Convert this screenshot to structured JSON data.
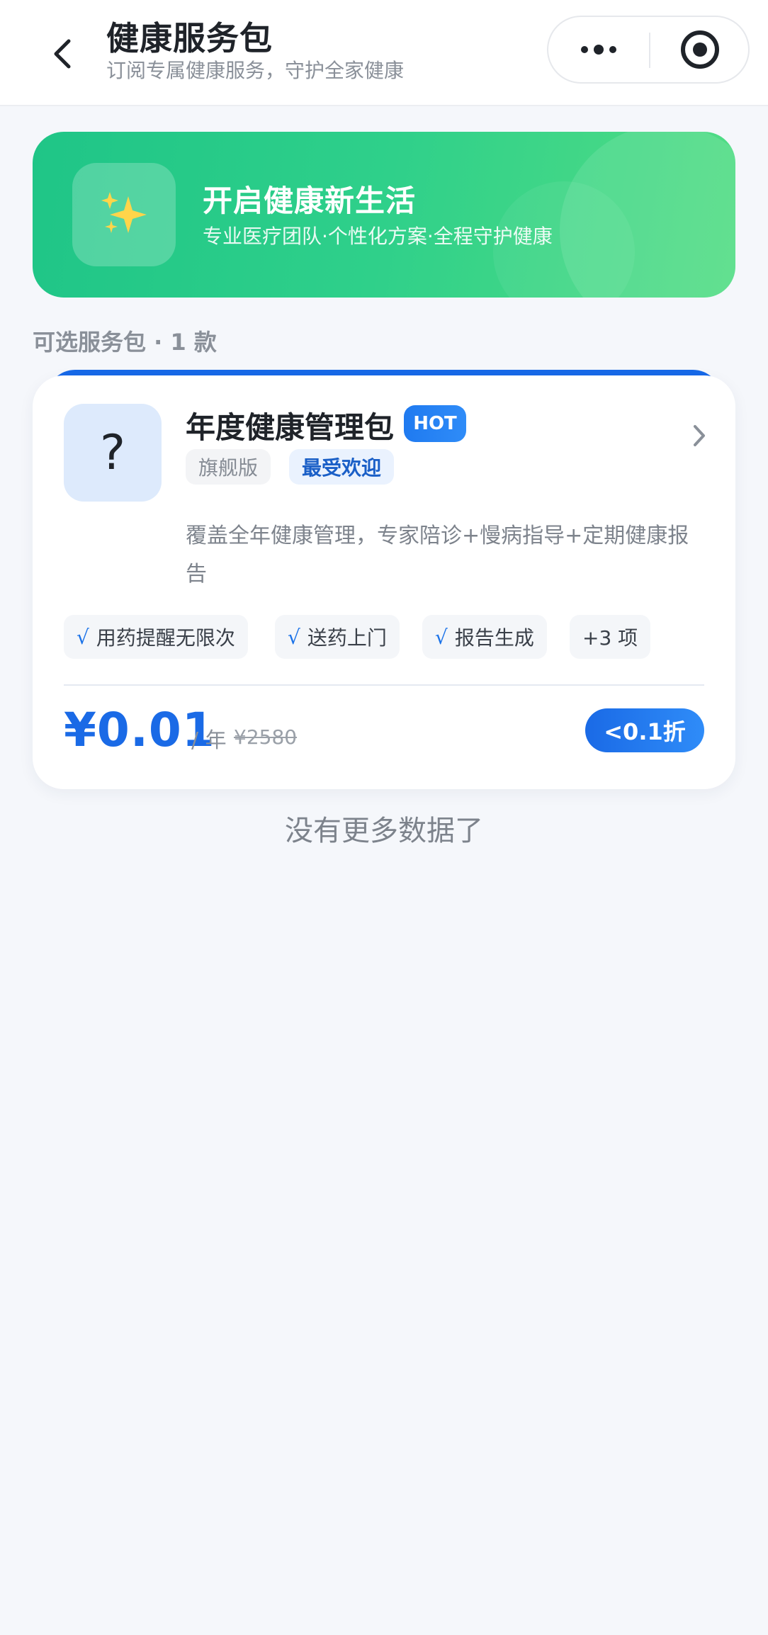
{
  "header": {
    "title": "健康服务包",
    "subtitle": "订阅专属健康服务，守护全家健康"
  },
  "banner": {
    "title": "开启健康新生活",
    "subtitle": "专业医疗团队·个性化方案·全程守护健康",
    "icon": "sparkles-icon"
  },
  "section": {
    "label": "可选服务包 · 1 款"
  },
  "product": {
    "icon_glyph": "?",
    "name": "年度健康管理包",
    "badge": "HOT",
    "edition": "旗舰版",
    "popular": "最受欢迎",
    "description": "覆盖全年健康管理，专家陪诊+慢病指导+定期健康报告",
    "features": [
      {
        "check": "√",
        "label": "用药提醒无限次"
      },
      {
        "check": "√",
        "label": "送药上门"
      },
      {
        "check": "√",
        "label": "报告生成"
      }
    ],
    "more_features": "+3 项",
    "price": "¥0.01",
    "price_unit": "/ 年",
    "original_price": "¥2580",
    "discount": "<0.1折"
  },
  "footer": {
    "no_more": "没有更多数据了"
  },
  "colors": {
    "brand_blue": "#1a6ae6",
    "banner_green": "#2fd08a",
    "background": "#f5f7fb"
  }
}
